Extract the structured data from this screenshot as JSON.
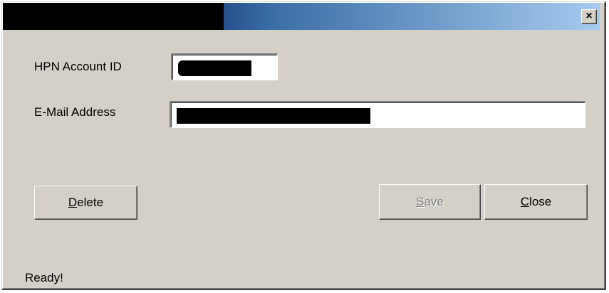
{
  "window": {
    "title": "",
    "close_glyph": "×",
    "close_icon": "close-icon",
    "titlebar_colors": [
      "#0a246a",
      "#3a6ea5",
      "#a6caf0"
    ]
  },
  "form": {
    "account_id_label": "HPN Account ID",
    "account_id_value": "",
    "email_label": "E-Mail Address",
    "email_value": ""
  },
  "buttons": {
    "delete_label_mnemonic": "D",
    "delete_label_rest": "elete",
    "save_label_mnemonic": "S",
    "save_label_rest": "ave",
    "close_label_mnemonic": "C",
    "close_label_rest": "lose"
  },
  "status": {
    "text": "Ready!"
  }
}
